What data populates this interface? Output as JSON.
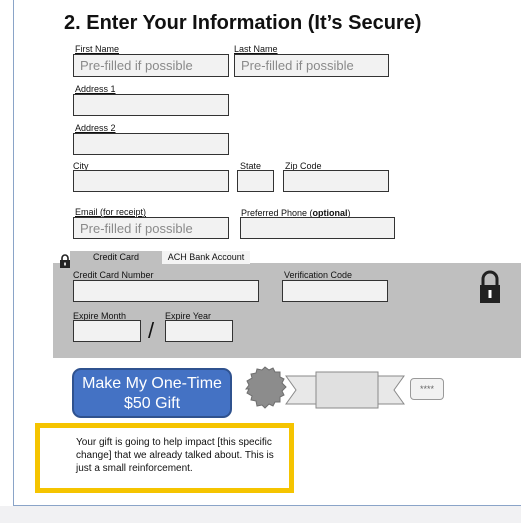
{
  "section": {
    "title": "2. Enter Your Information (It’s Secure)"
  },
  "form": {
    "first_name": {
      "label": "First Name",
      "placeholder": "Pre-filled if possible"
    },
    "last_name": {
      "label": "Last Name",
      "placeholder": "Pre-filled if possible"
    },
    "address1": {
      "label": "Address 1"
    },
    "address2": {
      "label": "Address 2"
    },
    "city": {
      "label": "City"
    },
    "state": {
      "label": "State"
    },
    "zip": {
      "label": "Zip Code"
    },
    "email": {
      "label": "Email (for receipt)",
      "placeholder": "Pre-filled if possible"
    },
    "phone": {
      "label_main": "Preferred Phone (",
      "label_bold": "optional",
      "label_end": ")"
    }
  },
  "payment": {
    "tabs": [
      {
        "label": "Credit Card"
      },
      {
        "label": "ACH Bank Account"
      }
    ],
    "card_number_label": "Credit Card Number",
    "verification_label": "Verification Code",
    "expire_month_label": "Expire Month",
    "expire_year_label": "Expire Year",
    "separator": "/"
  },
  "cta": {
    "label_line1": "Make My One-Time",
    "label_line2": "$50 Gift"
  },
  "badge": {
    "masked_text": "****"
  },
  "note": {
    "text": "Your gift is going to help impact [this specific change] that we already talked about. This is just a small reinforcement."
  },
  "colors": {
    "accent": "#4472c4",
    "highlight": "#f5c400",
    "panel": "#bfbfbf"
  }
}
